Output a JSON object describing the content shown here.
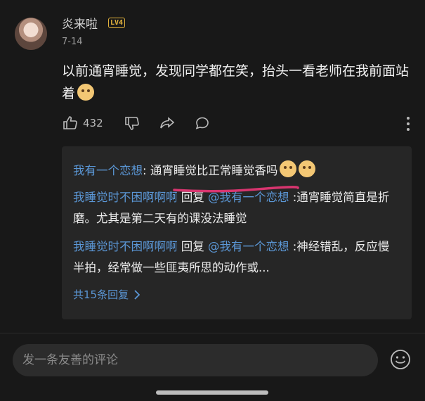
{
  "comment": {
    "username": "炎来啦",
    "level": "LV4",
    "date": "7-14",
    "text": "以前通宵睡觉，发现同学都在笑，抬头一看老师在我前面站着",
    "likes": "432"
  },
  "replies": [
    {
      "author": "我有一个恋想",
      "sep": ": ",
      "text": "通宵睡觉比正常睡觉香吗"
    },
    {
      "author": "我睡觉时不困啊啊啊",
      "mid": " 回复 ",
      "target": "@我有一个恋想",
      "text": " :通宵睡觉简直是折磨。尤其是第二天有的课没法睡觉"
    },
    {
      "author": "我睡觉时不困啊啊啊",
      "mid": " 回复 ",
      "target": "@我有一个恋想",
      "text": " :神经错乱，反应慢半拍，经常做一些匪夷所思的动作或..."
    }
  ],
  "expand_label": "共15条回复",
  "composer_placeholder": "发一条友善的评论",
  "colors": {
    "link": "#5b97d6",
    "underline": "#d8356f",
    "background": "#181818"
  },
  "icons": [
    "thumbs-up-icon",
    "thumbs-down-icon",
    "share-icon",
    "comment-icon",
    "more-icon",
    "chevron-right-icon",
    "emoji-icon"
  ]
}
